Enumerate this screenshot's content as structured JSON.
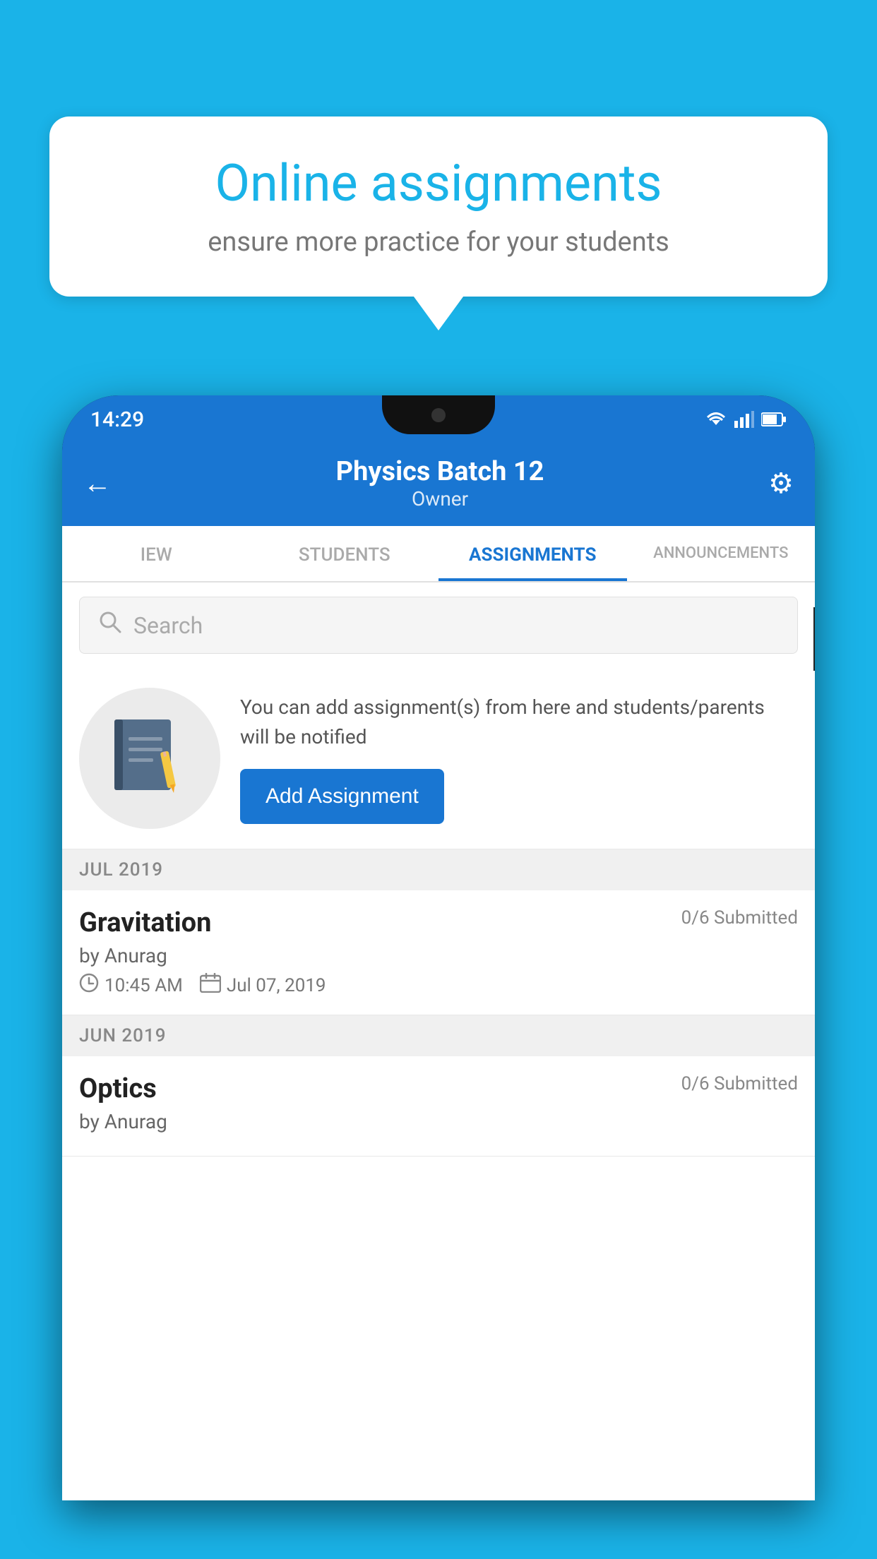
{
  "background": {
    "color": "#1ab3e8"
  },
  "speech_bubble": {
    "title": "Online assignments",
    "subtitle": "ensure more practice for your students"
  },
  "phone": {
    "status_bar": {
      "time": "14:29"
    },
    "header": {
      "title": "Physics Batch 12",
      "subtitle": "Owner",
      "back_icon": "←",
      "gear_icon": "⚙"
    },
    "tabs": [
      {
        "label": "IEW",
        "active": false
      },
      {
        "label": "STUDENTS",
        "active": false
      },
      {
        "label": "ASSIGNMENTS",
        "active": true
      },
      {
        "label": "ANNOUNCEMENTS",
        "active": false
      }
    ],
    "search": {
      "placeholder": "Search"
    },
    "promo": {
      "text": "You can add assignment(s) from here and students/parents will be notified",
      "button_label": "Add Assignment"
    },
    "sections": [
      {
        "month": "JUL 2019",
        "assignments": [
          {
            "name": "Gravitation",
            "submitted": "0/6 Submitted",
            "by": "by Anurag",
            "time": "10:45 AM",
            "date": "Jul 07, 2019"
          }
        ]
      },
      {
        "month": "JUN 2019",
        "assignments": [
          {
            "name": "Optics",
            "submitted": "0/6 Submitted",
            "by": "by Anurag",
            "time": "",
            "date": ""
          }
        ]
      }
    ]
  }
}
